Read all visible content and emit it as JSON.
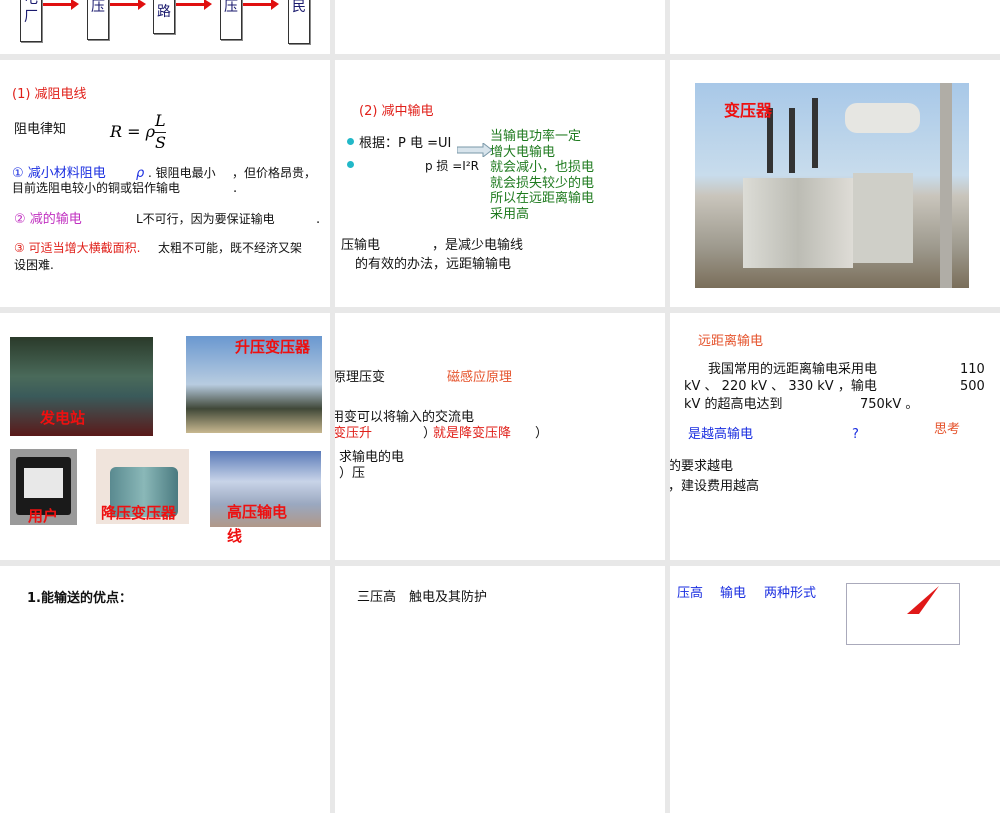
{
  "slides": {
    "s1": {
      "boxes": [
        "电厂",
        "变压",
        "线路",
        "变压",
        "/居民"
      ]
    },
    "s4": {
      "title": "(1) 减阻电线",
      "law": "阻电律知",
      "formula": {
        "lhs": "R = ρ",
        "num": "L",
        "den": "S"
      },
      "item1a": "① 减小材料阻电",
      "item1b": "ρ. 银阻电最小",
      "item1c": "，但价格昂贵，",
      "item1d": "目前选阻电较小的铜或铝作输电",
      "item1e": ".",
      "item2a": "② 减的输电",
      "item2b": "L不可行，因为要保证输电",
      "item2c": ".",
      "item3a": "③ 可适当增大横截面积.",
      "item3b": "太粗不可能，既不经济又架",
      "item3c": "设困难."
    },
    "s5": {
      "title": "(2) 减中输电",
      "line1": "根据：P 电 =UI",
      "line2": "p 损 =I²R",
      "green": [
        "当输电功率一定",
        "增大电输电",
        "就会减小，也损电",
        "就会损失较少的电",
        "所以在远距离输电",
        "采用高"
      ],
      "bottom1": "压输电　　　　，是减少电输线",
      "bottom2": "的有效的办法，远距输输电"
    },
    "s6": {
      "label": "变压器"
    },
    "s7": {
      "labels": [
        "发电站",
        "升压变压器",
        "用户",
        "降压变压器",
        "高压输电",
        "线"
      ]
    },
    "s8": {
      "l1a": "原理压变",
      "l1b": "磁感应原理",
      "l2": "用变可以将输入的交流电",
      "l3a": "变压升",
      "l3b": "）",
      "l3c": "就是降变压降",
      "l3d": "）",
      "l4": "求输电的电",
      "l5": "）压"
    },
    "s9": {
      "title": "远距离输电",
      "p1a": "我国常用的远距离输电采用电",
      "p1b": "110",
      "p2a": "kV 、 220 kV 、 330 kV ，输电",
      "p2b": "500",
      "p3a": "kV 的超高电达到",
      "p3b": "750kV 。",
      "q": "是越高输电",
      "qmark": "?",
      "think": "思考",
      "l1": "的要求越电",
      "l2": "，建设费用越高"
    },
    "s10": {
      "title": "1.能输送的优点："
    },
    "s11": {
      "title": "三压高　触电及其防护"
    },
    "s12": {
      "a": "压高",
      "b": "输电",
      "c": "两种形式"
    }
  }
}
